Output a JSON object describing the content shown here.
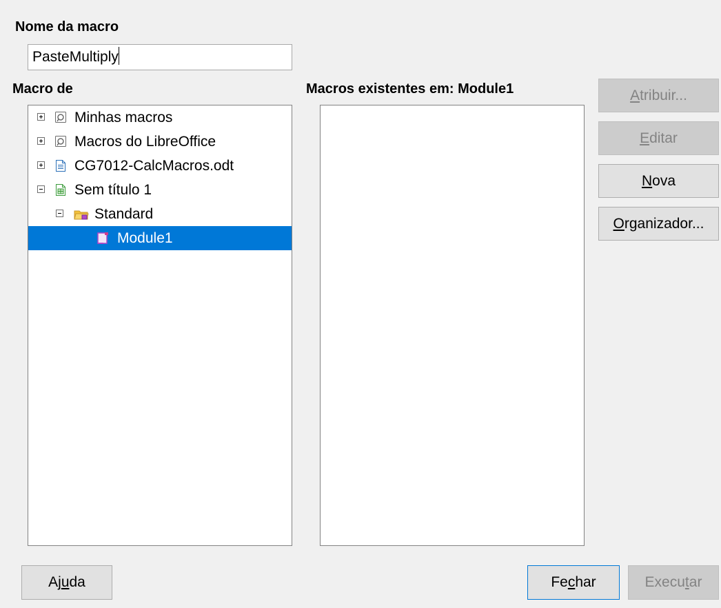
{
  "macro_name": {
    "label": "Nome da macro",
    "value": "PasteMultiply"
  },
  "macro_from": {
    "label": "Macro de",
    "items": [
      {
        "label": "Minhas macros",
        "icon": "macro-library-icon",
        "expander": "plus"
      },
      {
        "label": "Macros do LibreOffice",
        "icon": "macro-library-icon",
        "expander": "plus"
      },
      {
        "label": "CG7012-CalcMacros.odt",
        "icon": "document-icon",
        "expander": "plus"
      },
      {
        "label": "Sem título 1",
        "icon": "spreadsheet-icon",
        "expander": "minus"
      },
      {
        "label": "Standard",
        "icon": "library-folder-icon",
        "expander": "minus"
      },
      {
        "label": "Module1",
        "icon": "module-icon",
        "selected": true
      }
    ]
  },
  "existing_macros": {
    "label": "Macros existentes em: Module1",
    "items": []
  },
  "buttons": {
    "assign": {
      "pre": "",
      "key": "A",
      "post": "tribuir...",
      "enabled": false
    },
    "edit": {
      "pre": "",
      "key": "E",
      "post": "ditar",
      "enabled": false
    },
    "new": {
      "pre": "",
      "key": "N",
      "post": "ova",
      "enabled": true
    },
    "organizer": {
      "pre": "",
      "key": "O",
      "post": "rganizador...",
      "enabled": true
    },
    "help": {
      "pre": "Aj",
      "key": "u",
      "post": "da",
      "enabled": true
    },
    "close": {
      "pre": "Fe",
      "key": "c",
      "post": "har",
      "enabled": true
    },
    "run": {
      "pre": "Execu",
      "key": "t",
      "post": "ar",
      "enabled": false
    }
  },
  "colors": {
    "selection": "#0078d7",
    "dialog_bg": "#f0f0f0"
  }
}
